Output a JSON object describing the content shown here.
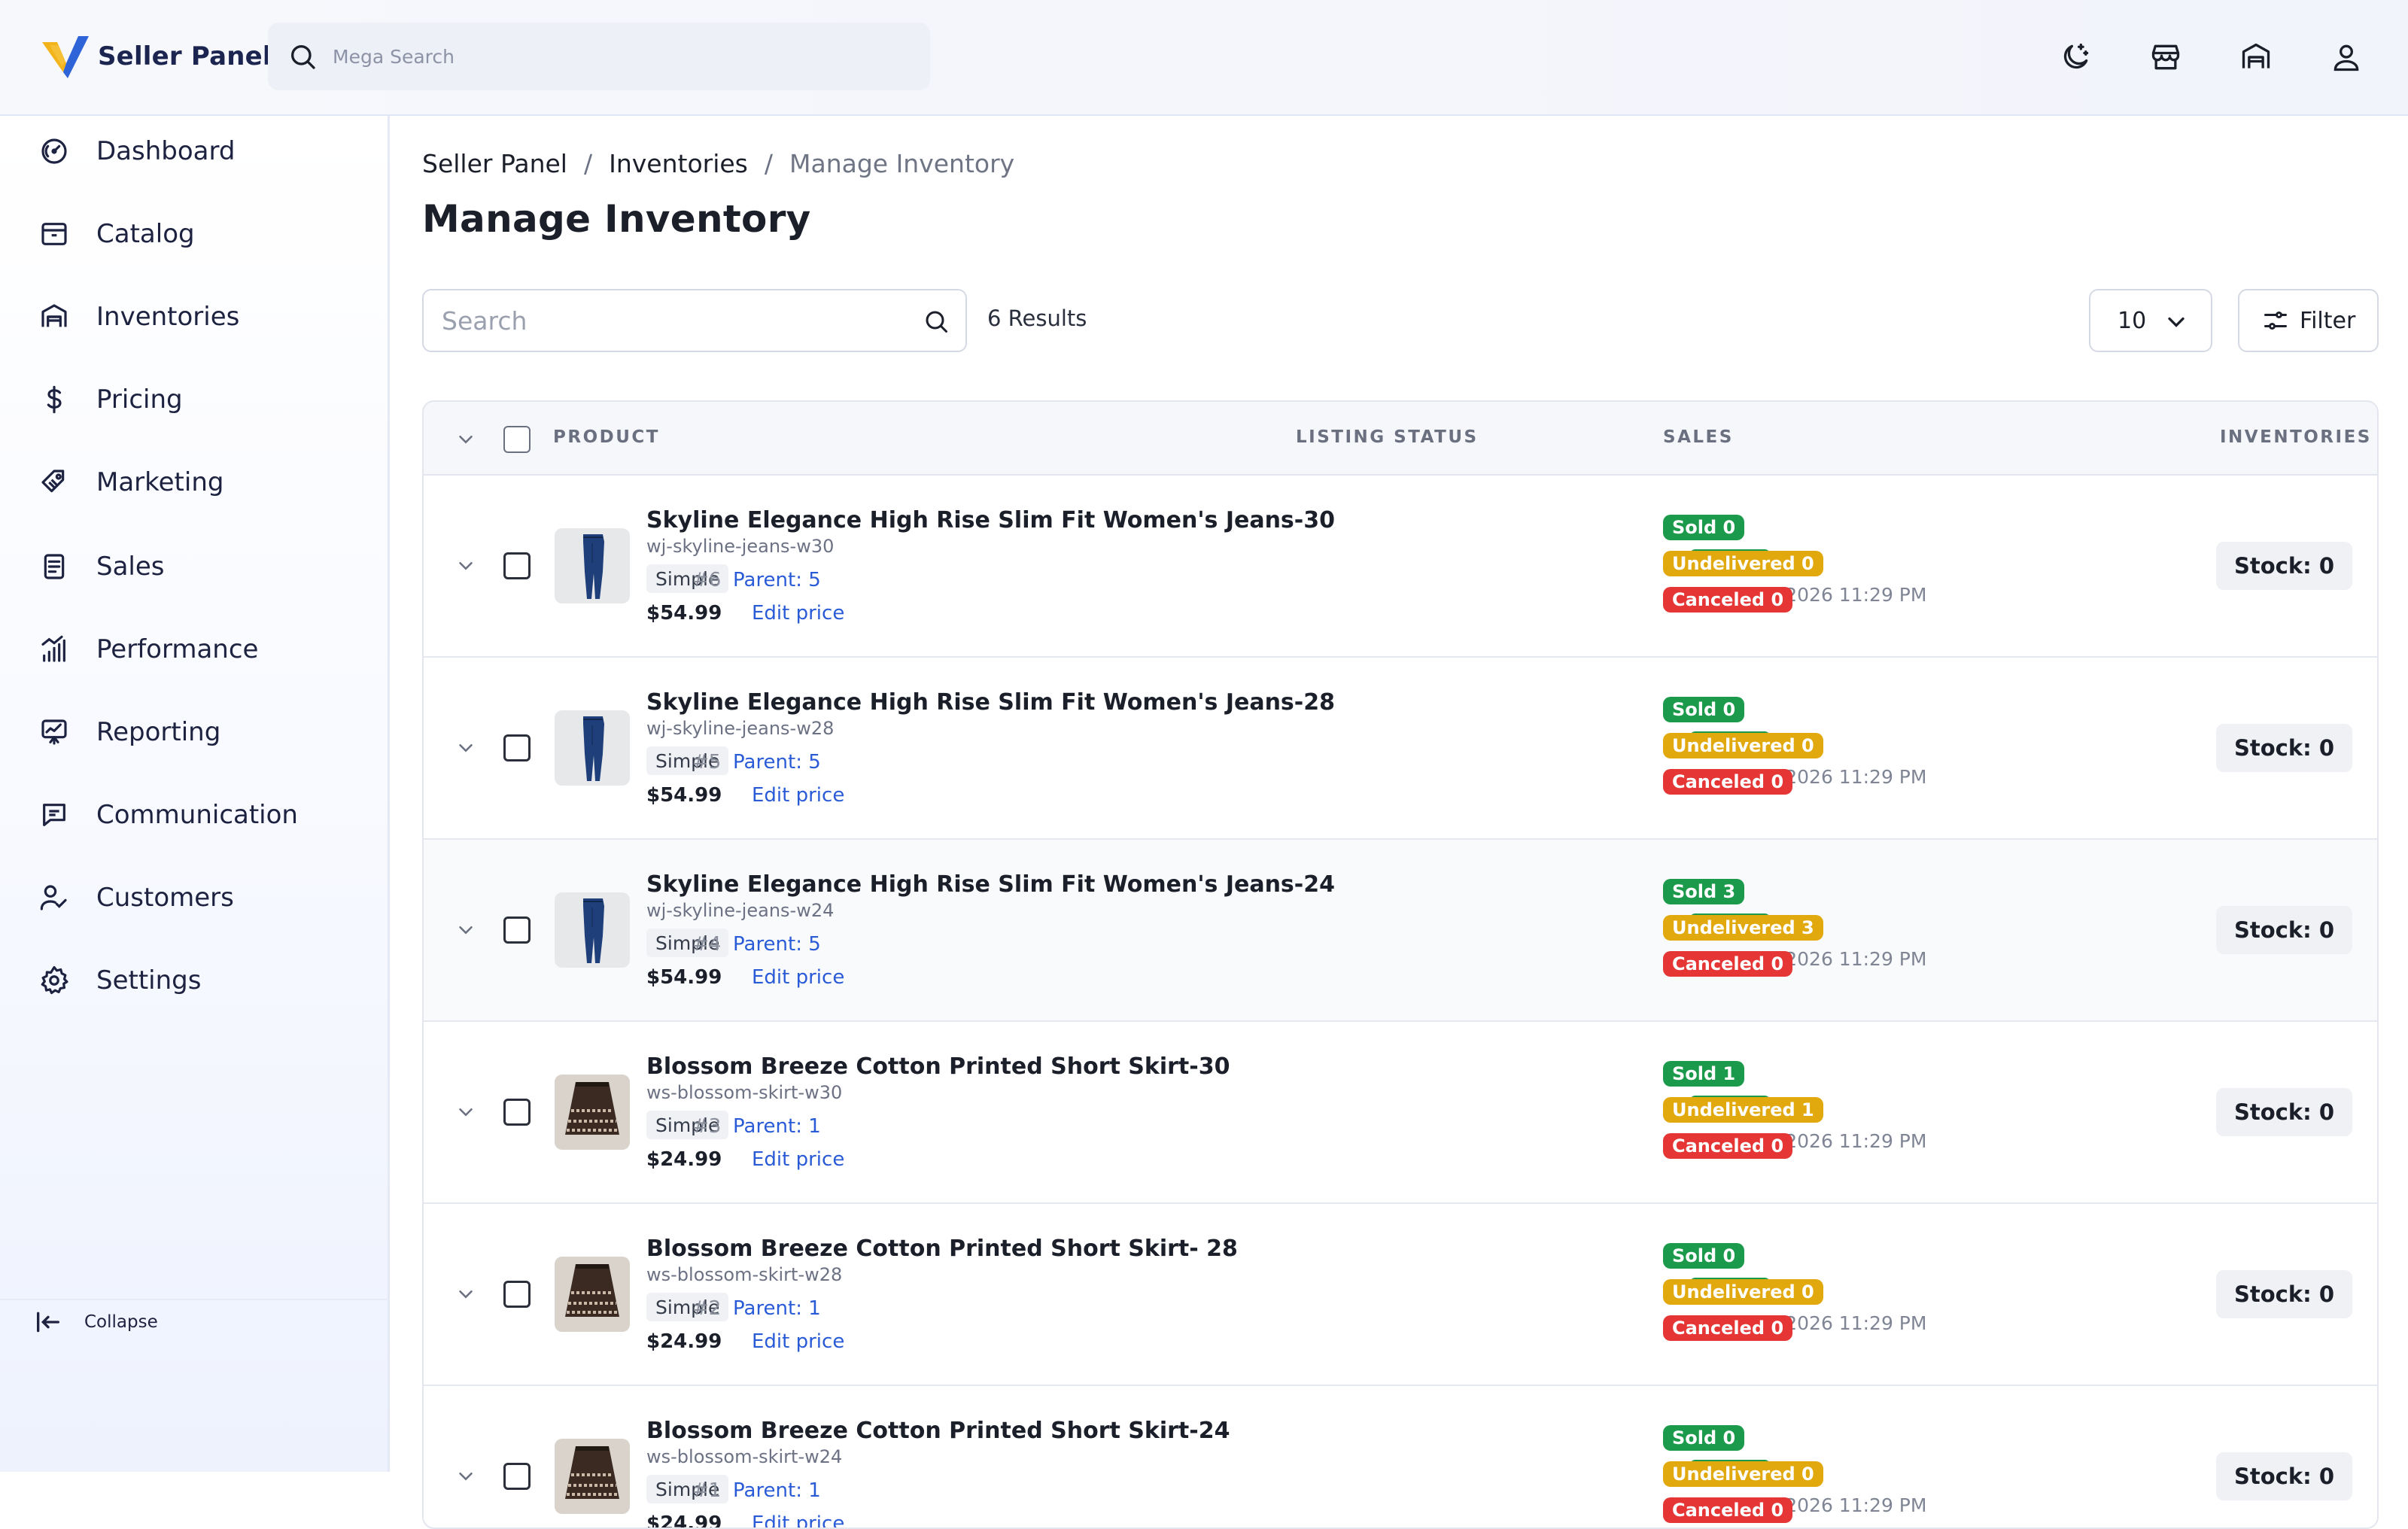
{
  "header": {
    "app_name": "Seller Panel",
    "mega_search_placeholder": "Mega Search",
    "icons": [
      "moon-icon",
      "store-icon",
      "warehouse-icon",
      "user-icon"
    ]
  },
  "sidebar": {
    "items": [
      {
        "label": "Dashboard",
        "icon": "dashboard-gauge-icon"
      },
      {
        "label": "Catalog",
        "icon": "catalog-box-icon"
      },
      {
        "label": "Inventories",
        "icon": "warehouse-icon"
      },
      {
        "label": "Pricing",
        "icon": "dollar-icon"
      },
      {
        "label": "Marketing",
        "icon": "tag-icon"
      },
      {
        "label": "Sales",
        "icon": "receipt-icon"
      },
      {
        "label": "Performance",
        "icon": "signal-bars-icon"
      },
      {
        "label": "Reporting",
        "icon": "chart-report-icon"
      },
      {
        "label": "Communication",
        "icon": "message-icon"
      },
      {
        "label": "Customers",
        "icon": "customers-icon"
      },
      {
        "label": "Settings",
        "icon": "gear-icon"
      }
    ],
    "collapse_label": "Collapse"
  },
  "breadcrumb": {
    "items": [
      "Seller Panel",
      "Inventories"
    ],
    "separator": "/",
    "current": "Manage Inventory"
  },
  "page_title": "Manage Inventory",
  "toolbar": {
    "search_placeholder": "Search",
    "results": "6 Results",
    "per_page": "10",
    "filter_label": "Filter"
  },
  "table": {
    "columns": [
      "PRODUCT",
      "LISTING STATUS",
      "SALES",
      "INVENTORIES"
    ],
    "rows": [
      {
        "name": "Skyline Elegance High Rise Slim Fit Women's Jeans-30",
        "sku": "wj-skyline-jeans-w30",
        "type": "Simple",
        "number": "#6",
        "parent": "Parent: 5",
        "price": "$54.99",
        "edit": "Edit price",
        "status": "Active",
        "date": "August 6, 2026 11:29 PM",
        "sold": "Sold 0",
        "undelivered": "Undelivered 0",
        "canceled": "Canceled 0",
        "stock": "Stock: 0",
        "thumb": "jeans"
      },
      {
        "name": "Skyline Elegance High Rise Slim Fit Women's Jeans-28",
        "sku": "wj-skyline-jeans-w28",
        "type": "Simple",
        "number": "#5",
        "parent": "Parent: 5",
        "price": "$54.99",
        "edit": "Edit price",
        "status": "Active",
        "date": "August 6, 2026 11:29 PM",
        "sold": "Sold 0",
        "undelivered": "Undelivered 0",
        "canceled": "Canceled 0",
        "stock": "Stock: 0",
        "thumb": "jeans"
      },
      {
        "name": "Skyline Elegance High Rise Slim Fit Women's Jeans-24",
        "sku": "wj-skyline-jeans-w24",
        "type": "Simple",
        "number": "#4",
        "parent": "Parent: 5",
        "price": "$54.99",
        "edit": "Edit price",
        "status": "Active",
        "date": "August 6, 2026 11:29 PM",
        "sold": "Sold 3",
        "undelivered": "Undelivered 3",
        "canceled": "Canceled 0",
        "stock": "Stock: 0",
        "thumb": "jeans"
      },
      {
        "name": "Blossom Breeze Cotton Printed Short Skirt-30",
        "sku": "ws-blossom-skirt-w30",
        "type": "Simple",
        "number": "#3",
        "parent": "Parent: 1",
        "price": "$24.99",
        "edit": "Edit price",
        "status": "Active",
        "date": "August 6, 2026 11:29 PM",
        "sold": "Sold 1",
        "undelivered": "Undelivered 1",
        "canceled": "Canceled 0",
        "stock": "Stock: 0",
        "thumb": "skirt"
      },
      {
        "name": "Blossom Breeze Cotton Printed Short Skirt- 28",
        "sku": "ws-blossom-skirt-w28",
        "type": "Simple",
        "number": "#2",
        "parent": "Parent: 1",
        "price": "$24.99",
        "edit": "Edit price",
        "status": "Active",
        "date": "August 6, 2026 11:29 PM",
        "sold": "Sold 0",
        "undelivered": "Undelivered 0",
        "canceled": "Canceled 0",
        "stock": "Stock: 0",
        "thumb": "skirt"
      },
      {
        "name": "Blossom Breeze Cotton Printed Short Skirt-24",
        "sku": "ws-blossom-skirt-w24",
        "type": "Simple",
        "number": "#1",
        "parent": "Parent: 1",
        "price": "$24.99",
        "edit": "Edit price",
        "status": "Active",
        "date": "August 6, 2026 11:29 PM",
        "sold": "Sold 0",
        "undelivered": "Undelivered 0",
        "canceled": "Canceled 0",
        "stock": "Stock: 0",
        "thumb": "skirt"
      }
    ]
  },
  "colors": {
    "active": "#1c9a4b",
    "sold": "#1c9a4b",
    "undelivered": "#e2a90e",
    "canceled": "#e53535",
    "link": "#2a5bd7",
    "logo_yellow": "#f2b31b",
    "logo_blue": "#2f63d8"
  }
}
